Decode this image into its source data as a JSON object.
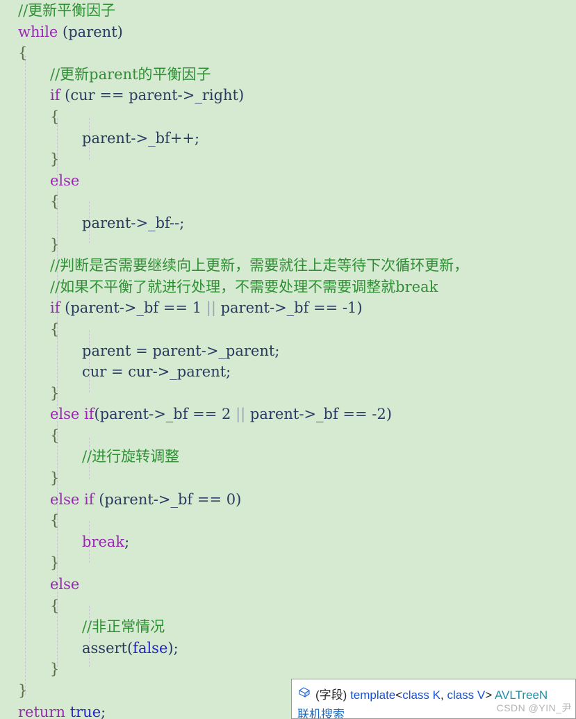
{
  "editor": {
    "background_color": "#d6ead1",
    "font_size_px": 21,
    "line_height_px": 30.6,
    "indent_guide_color": "#c9bed4",
    "colors": {
      "keyword": "#9b26b6",
      "literal_keyword": "#2323c8",
      "comment": "#2f8f34",
      "identifier": "#2a3a63",
      "brace": "#5b6a47",
      "logical_or": "#9aa3b5"
    },
    "lines": [
      {
        "indent": 0,
        "tokens": [
          {
            "t": "//更新平衡因子",
            "c": "cmt"
          }
        ]
      },
      {
        "indent": 0,
        "tokens": [
          {
            "t": "while",
            "c": "kw"
          },
          {
            "t": " (parent)",
            "c": "plain"
          }
        ]
      },
      {
        "indent": 0,
        "tokens": [
          {
            "t": "{",
            "c": "brace"
          }
        ]
      },
      {
        "indent": 1,
        "tokens": [
          {
            "t": "//更新parent的平衡因子",
            "c": "cmt"
          }
        ]
      },
      {
        "indent": 1,
        "tokens": [
          {
            "t": "if",
            "c": "kw"
          },
          {
            "t": " (cur == parent->_right)",
            "c": "plain"
          }
        ]
      },
      {
        "indent": 1,
        "tokens": [
          {
            "t": "{",
            "c": "brace"
          }
        ]
      },
      {
        "indent": 2,
        "tokens": [
          {
            "t": "parent->_bf++;",
            "c": "plain"
          }
        ]
      },
      {
        "indent": 1,
        "tokens": [
          {
            "t": "}",
            "c": "brace"
          }
        ]
      },
      {
        "indent": 1,
        "tokens": [
          {
            "t": "else",
            "c": "kw"
          }
        ]
      },
      {
        "indent": 1,
        "tokens": [
          {
            "t": "{",
            "c": "brace"
          }
        ]
      },
      {
        "indent": 2,
        "tokens": [
          {
            "t": "parent->_bf--;",
            "c": "plain"
          }
        ]
      },
      {
        "indent": 1,
        "tokens": [
          {
            "t": "}",
            "c": "brace"
          }
        ]
      },
      {
        "indent": 1,
        "tokens": [
          {
            "t": "//判断是否需要继续向上更新，需要就往上走等待下次循环更新，",
            "c": "cmt"
          }
        ]
      },
      {
        "indent": 1,
        "tokens": [
          {
            "t": "//如果不平衡了就进行处理，不需要处理不需要调整就break",
            "c": "cmt"
          }
        ]
      },
      {
        "indent": 1,
        "tokens": [
          {
            "t": "if",
            "c": "kw"
          },
          {
            "t": " (parent->_bf == 1 ",
            "c": "plain"
          },
          {
            "t": "||",
            "c": "orbar"
          },
          {
            "t": " parent->_bf == -1)",
            "c": "plain"
          }
        ]
      },
      {
        "indent": 1,
        "tokens": [
          {
            "t": "{",
            "c": "brace"
          }
        ]
      },
      {
        "indent": 2,
        "tokens": [
          {
            "t": "parent = parent->_parent;",
            "c": "plain"
          }
        ]
      },
      {
        "indent": 2,
        "tokens": [
          {
            "t": "cur = cur->_parent;",
            "c": "plain"
          }
        ]
      },
      {
        "indent": 1,
        "tokens": [
          {
            "t": "}",
            "c": "brace"
          }
        ]
      },
      {
        "indent": 1,
        "tokens": [
          {
            "t": "else if",
            "c": "kw"
          },
          {
            "t": "(parent->_bf == 2 ",
            "c": "plain"
          },
          {
            "t": "||",
            "c": "orbar"
          },
          {
            "t": " parent->_bf == -2)",
            "c": "plain"
          }
        ]
      },
      {
        "indent": 1,
        "tokens": [
          {
            "t": "{",
            "c": "brace"
          }
        ]
      },
      {
        "indent": 2,
        "tokens": [
          {
            "t": "//进行旋转调整",
            "c": "cmt"
          }
        ]
      },
      {
        "indent": 1,
        "tokens": [
          {
            "t": "}",
            "c": "brace"
          }
        ]
      },
      {
        "indent": 1,
        "tokens": [
          {
            "t": "else if",
            "c": "kw"
          },
          {
            "t": " (parent->_bf == 0)",
            "c": "plain"
          }
        ]
      },
      {
        "indent": 1,
        "tokens": [
          {
            "t": "{",
            "c": "brace"
          }
        ]
      },
      {
        "indent": 2,
        "tokens": [
          {
            "t": "break",
            "c": "kw"
          },
          {
            "t": ";",
            "c": "plain"
          }
        ]
      },
      {
        "indent": 1,
        "tokens": [
          {
            "t": "}",
            "c": "brace"
          }
        ]
      },
      {
        "indent": 1,
        "tokens": [
          {
            "t": "else",
            "c": "kw"
          }
        ]
      },
      {
        "indent": 1,
        "tokens": [
          {
            "t": "{",
            "c": "brace"
          }
        ]
      },
      {
        "indent": 2,
        "tokens": [
          {
            "t": "//非正常情况",
            "c": "cmt"
          }
        ]
      },
      {
        "indent": 2,
        "tokens": [
          {
            "t": "assert(",
            "c": "plain"
          },
          {
            "t": "false",
            "c": "kw2"
          },
          {
            "t": ");",
            "c": "plain"
          }
        ]
      },
      {
        "indent": 1,
        "tokens": [
          {
            "t": "}",
            "c": "brace"
          }
        ]
      },
      {
        "indent": 0,
        "tokens": [
          {
            "t": "}",
            "c": "brace"
          }
        ]
      },
      {
        "indent": 0,
        "tokens": [
          {
            "t": "return",
            "c": "kw"
          },
          {
            "t": " ",
            "c": "plain"
          },
          {
            "t": "true",
            "c": "kw2"
          },
          {
            "t": ";",
            "c": "plain"
          }
        ]
      }
    ]
  },
  "tooltip": {
    "icon_name": "field-icon",
    "kind_label": "(字段)",
    "signature_template": "template",
    "signature_angle_open": "<",
    "signature_class_k": "class K",
    "signature_comma": ", ",
    "signature_class_v": "class V",
    "signature_angle_close": "> ",
    "signature_type": "AVLTreeN",
    "search_link": "联机搜索"
  },
  "watermark": {
    "text": "CSDN @YIN_尹"
  }
}
